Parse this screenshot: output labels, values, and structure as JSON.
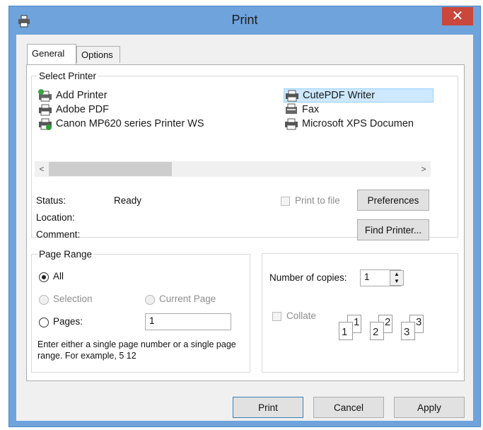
{
  "window": {
    "title": "Print",
    "close_glyph": "✕"
  },
  "tabs": [
    {
      "label": "General"
    },
    {
      "label": "Options"
    }
  ],
  "select_printer": {
    "legend": "Select Printer",
    "printers": [
      {
        "name": "Add Printer",
        "icon": "add-printer-icon"
      },
      {
        "name": "Adobe PDF",
        "icon": "printer-icon"
      },
      {
        "name": "Canon MP620 series Printer WS",
        "icon": "printer-check-icon"
      },
      {
        "name": "CutePDF Writer",
        "icon": "printer-icon",
        "selected": true
      },
      {
        "name": "Fax",
        "icon": "fax-icon"
      },
      {
        "name": "Microsoft XPS Documen",
        "icon": "printer-icon"
      }
    ],
    "scroll_left": "<",
    "scroll_right": ">",
    "status_label": "Status:",
    "status_value": "Ready",
    "location_label": "Location:",
    "comment_label": "Comment:",
    "print_to_file_label": "Print to file",
    "preferences_label": "Preferences",
    "find_printer_label": "Find Printer..."
  },
  "page_range": {
    "legend": "Page Range",
    "all_label": "All",
    "selection_label": "Selection",
    "current_page_label": "Current Page",
    "pages_label": "Pages:",
    "pages_value": "1",
    "selected": "All",
    "hint": "Enter either a single page number or a single page range.  For example, 5 12"
  },
  "copies": {
    "number_label": "Number of copies:",
    "number_value": "1",
    "collate_label": "Collate",
    "collate_pages": [
      "1",
      "1",
      "2",
      "2",
      "3",
      "3"
    ]
  },
  "footer": {
    "print_label": "Print",
    "cancel_label": "Cancel",
    "apply_label": "Apply"
  },
  "colors": {
    "title_bar": "#6fa3dc",
    "close_button": "#c9473b",
    "selection": "#cde8ff"
  }
}
